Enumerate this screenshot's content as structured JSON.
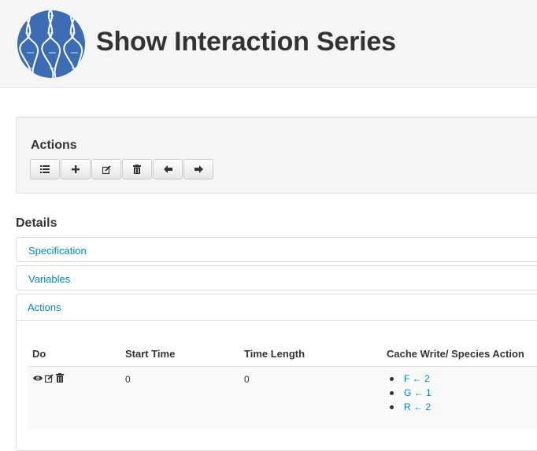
{
  "header": {
    "title": "Show Interaction Series",
    "logo_icon": "dna-helix-logo",
    "logo_color": "#3b6cb4"
  },
  "actions_well": {
    "title": "Actions",
    "buttons": [
      {
        "icon": "list-icon"
      },
      {
        "icon": "plus-icon"
      },
      {
        "icon": "edit-icon"
      },
      {
        "icon": "trash-icon"
      },
      {
        "icon": "arrow-left-icon"
      },
      {
        "icon": "arrow-right-icon"
      }
    ]
  },
  "details": {
    "title": "Details",
    "panels": [
      {
        "label": "Specification"
      },
      {
        "label": "Variables"
      },
      {
        "label": "Actions"
      }
    ]
  },
  "actions_table": {
    "columns": [
      "Do",
      "Start Time",
      "Time Length",
      "Cache Write/ Species Action"
    ],
    "rows": [
      {
        "do_icons": [
          "eye-icon",
          "edit-icon",
          "trash-icon"
        ],
        "start_time": "0",
        "time_length": "0",
        "cache_write": [
          "F ← 2",
          "G ← 1",
          "R ← 2"
        ]
      }
    ]
  },
  "colors": {
    "link": "#0088cc",
    "text": "#333333",
    "header_bg": "#f5f5f5"
  }
}
